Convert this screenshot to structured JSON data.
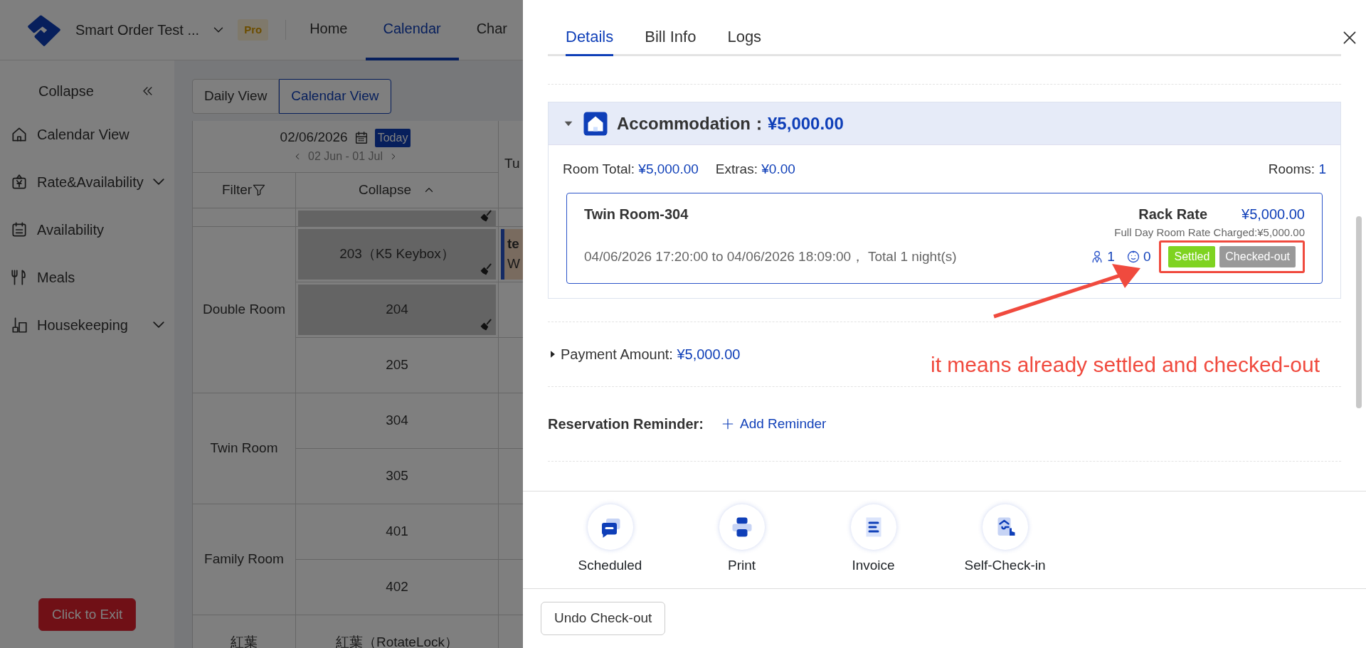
{
  "header": {
    "hotel_name": "Smart Order Test ...",
    "plan_badge": "Pro",
    "nav": [
      {
        "label": "Home",
        "selected": false
      },
      {
        "label": "Calendar",
        "selected": true
      },
      {
        "label": "Char",
        "selected": false
      }
    ]
  },
  "sidebar": {
    "collapse_label": "Collapse",
    "items": [
      {
        "label": "Calendar View",
        "expandable": false
      },
      {
        "label": "Rate&Availability",
        "expandable": true
      },
      {
        "label": "Availability",
        "expandable": false
      },
      {
        "label": "Meals",
        "expandable": false
      },
      {
        "label": "Housekeeping",
        "expandable": true
      }
    ],
    "exit_button": "Click to Exit"
  },
  "view_toggle": [
    {
      "label": "Daily View",
      "selected": false
    },
    {
      "label": "Calendar View",
      "selected": true
    }
  ],
  "calendar": {
    "date": "02/06/2026",
    "today": "Today",
    "range": "02 Jun - 01 Jul",
    "filter": "Filter",
    "collapse": "Collapse",
    "day_column": "Tu",
    "groups": [
      {
        "rooms": [
          {
            "dirty": true
          }
        ]
      },
      {
        "type": "Double Room",
        "rooms": [
          {
            "name": "203（K5 Keybox）",
            "dirty": true,
            "booking": {
              "guest": "te",
              "detail": "W"
            }
          },
          {
            "name": "204",
            "dirty": true
          },
          {
            "name": "205",
            "dirty": false
          }
        ]
      },
      {
        "type": "Twin Room",
        "rooms": [
          {
            "name": "304",
            "dirty": false
          },
          {
            "name": "305",
            "dirty": false
          }
        ]
      },
      {
        "type": "Family Room",
        "rooms": [
          {
            "name": "401",
            "dirty": false
          },
          {
            "name": "402",
            "dirty": false
          }
        ]
      },
      {
        "type": "紅葉",
        "rooms": [
          {
            "name": "紅葉（RotateLock）",
            "dirty": false
          }
        ]
      }
    ]
  },
  "drawer": {
    "tabs": [
      {
        "label": "Details",
        "selected": true
      },
      {
        "label": "Bill Info",
        "selected": false
      },
      {
        "label": "Logs",
        "selected": false
      }
    ],
    "accommodation": {
      "label": "Accommodation：",
      "amount": "¥5,000.00",
      "expanded": true,
      "room_total_label": "Room Total:",
      "room_total": "¥5,000.00",
      "extras_label": "Extras:",
      "extras": "¥0.00",
      "rooms_label": "Rooms:",
      "rooms": "1",
      "stay": {
        "room": "Twin Room-304",
        "rate_name": "Rack Rate",
        "rate": "¥5,000.00",
        "charged": "Full Day Room Rate Charged:¥5,000.00",
        "period": "04/06/2026 17:20:00 to 04/06/2026 18:09:00， Total 1 night(s)",
        "adults": "1",
        "children": "0",
        "statuses": [
          {
            "label": "Settled",
            "color": "#7ed321"
          },
          {
            "label": "Checked-out",
            "color": "#999999"
          }
        ]
      }
    },
    "payment": {
      "label": "Payment Amount:",
      "amount": "¥5,000.00",
      "expanded": false
    },
    "reminder": {
      "label": "Reservation Reminder:",
      "action": "Add Reminder"
    },
    "actions": [
      "Scheduled",
      "Print",
      "Invoice",
      "Self-Check-in"
    ],
    "footer_button": "Undo Check-out",
    "annotation": {
      "text": "it means already settled and checked-out"
    }
  }
}
